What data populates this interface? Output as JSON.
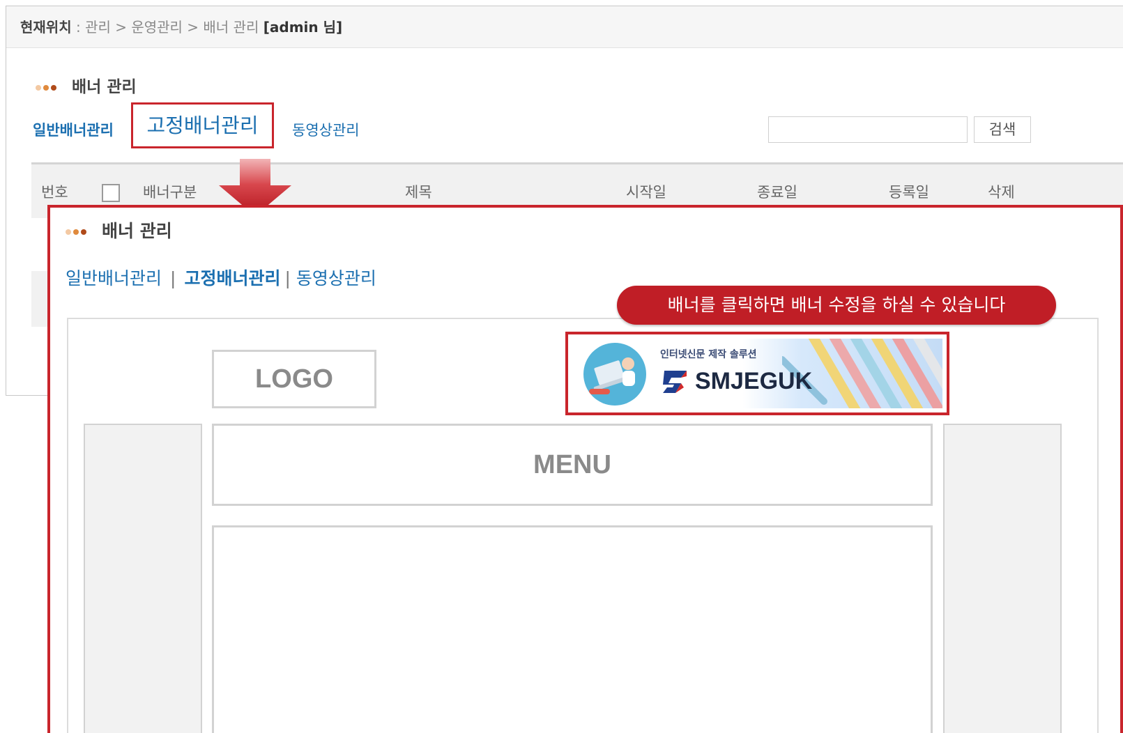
{
  "breadcrumb": {
    "label": "현재위치",
    "path": ": 관리 > 운영관리 > 배너 관리",
    "user": "[admin 님]"
  },
  "background": {
    "title": "배너 관리",
    "tabs": {
      "general": "일반배너관리",
      "video": "동영상관리"
    },
    "search": {
      "value": "",
      "button": "검색"
    },
    "table_headers": [
      "번호",
      "배너구분",
      "제목",
      "시작일",
      "종료일",
      "등록일",
      "삭제"
    ]
  },
  "highlighted_tab": "고정배너관리",
  "detail": {
    "title": "배너 관리",
    "tabs": [
      {
        "label": "일반배너관리",
        "active": false
      },
      {
        "label": "고정배너관리",
        "active": true
      },
      {
        "label": "동영상관리",
        "active": false
      }
    ],
    "separator": "|",
    "tooltip": "배너를 클릭하면 배너 수정을 하실 수 있습니다",
    "layout": {
      "logo": "LOGO",
      "menu": "MENU"
    },
    "banner": {
      "subtitle": "인터넷신문 제작 솔루션",
      "brand": "SMJEGUK"
    }
  },
  "colors": {
    "highlight": "#c9252c",
    "link": "#1b6fb0",
    "tooltip_bg": "#c01e26"
  },
  "icons": [
    "dots-bullet-icon",
    "down-arrow-icon",
    "checkbox-icon",
    "smjeguk-logo-icon"
  ]
}
